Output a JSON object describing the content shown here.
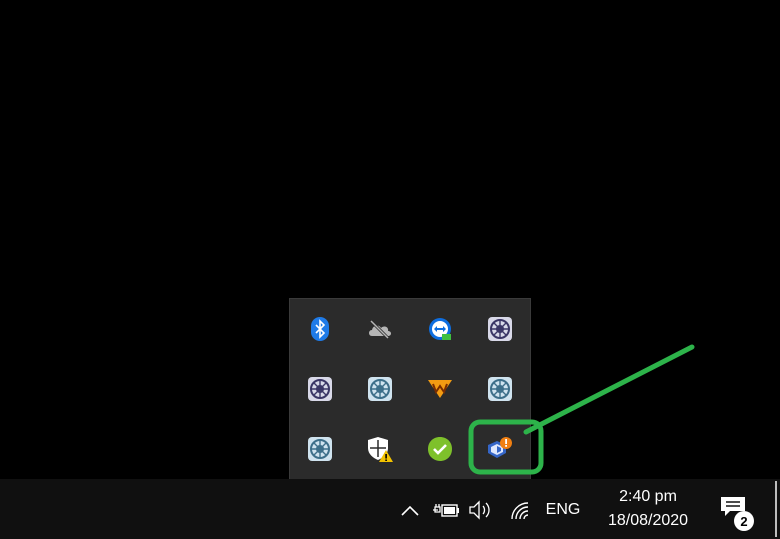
{
  "taskbar": {
    "language": "ENG",
    "clock_time": "2:40 pm",
    "clock_date": "18/08/2020",
    "notification_count": "2"
  },
  "tray_icons": [
    "bluetooth-icon",
    "onedrive-offline-icon",
    "teamviewer-icon",
    "network-app-icon",
    "network-app-icon",
    "network-app-icon",
    "winrar-like-icon",
    "network-app-icon",
    "network-app-icon",
    "windows-security-warning-icon",
    "green-check-app-icon",
    "shield-alert-app-icon"
  ],
  "colors": {
    "annotation": "#2db34a",
    "taskbar": "#101010",
    "flyout": "#2b2b2b"
  }
}
